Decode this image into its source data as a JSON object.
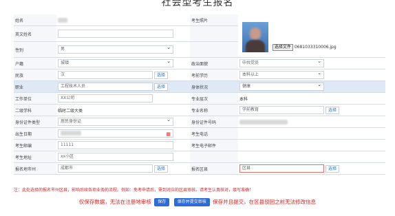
{
  "page_title": "社会型考生报名",
  "rows": {
    "name": {
      "label": "姓名"
    },
    "english_name": {
      "label": "英文姓名"
    },
    "photo": {
      "label": "考生照片",
      "button": "选择文件",
      "filename": "0681033310006.jpg"
    },
    "gender": {
      "label": "性别",
      "value": "男"
    },
    "hukou": {
      "label": "户籍",
      "value": "城镇"
    },
    "politics": {
      "label": "政治面貌",
      "value": "中共党员"
    },
    "ethnicity": {
      "label": "民族",
      "value": "汉"
    },
    "education": {
      "label": "考前学历",
      "value": "本科以上"
    },
    "occupation": {
      "label": "职业",
      "value": "工程技术人员"
    },
    "health": {
      "label": "身体状况",
      "value": "健康"
    },
    "employer": {
      "label": "工作单位",
      "value": "XX公司"
    },
    "major_level": {
      "label": "专业层次",
      "value": "本科"
    },
    "secondary_subject": {
      "label": "二级学科",
      "value": "临时二级大类"
    },
    "major_name": {
      "label": "专业名称",
      "value": "学前教育"
    },
    "id_type": {
      "label": "身份证件类型",
      "value": "居民身份证"
    },
    "id_number": {
      "label": "身份证件号码"
    },
    "birthdate": {
      "label": "出生日期"
    },
    "phone": {
      "label": "考生电话"
    },
    "postcode": {
      "label": "考生邮编",
      "value": "11111"
    },
    "email": {
      "label": "考生电子邮件"
    },
    "address": {
      "label": "考生地址",
      "value": "xx小区"
    },
    "city": {
      "label": "报名地市州",
      "value": "成都市"
    },
    "district": {
      "label": "报名区县",
      "value": "区县"
    }
  },
  "pick_label": "选择",
  "notice": "注：此处选择的报名市州区县，影响后续各项业务的流程。例如：免考申请后，需到对应的区县审核。请考生认真核对，填写准确！",
  "bottom": {
    "prefix": "仅保存数据，无法在注册地审核",
    "save": "保存",
    "save_submit": "保存并提交审核",
    "suffix": "保存并且提交，在区县驳回之前无法修改信息"
  },
  "colors": {
    "accent": "#2d6bd6",
    "warning": "#e02020",
    "label_bg": "#f5f7fb"
  }
}
